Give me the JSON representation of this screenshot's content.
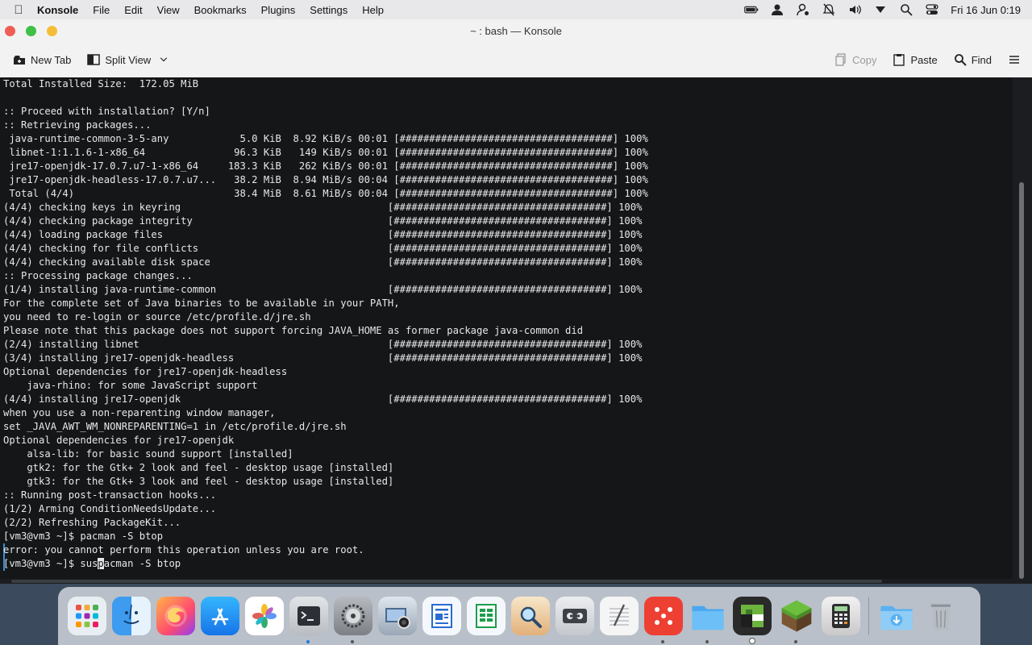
{
  "menubar": {
    "app_name": "Konsole",
    "menus": [
      "File",
      "Edit",
      "View",
      "Bookmarks",
      "Plugins",
      "Settings",
      "Help"
    ],
    "clock": "Fri 16 Jun 0:19"
  },
  "window": {
    "title": "~ : bash — Konsole"
  },
  "toolbar": {
    "new_tab": "New Tab",
    "split_view": "Split View",
    "copy": "Copy",
    "paste": "Paste",
    "find": "Find"
  },
  "terminal": {
    "lines": [
      "Total Installed Size:  172.05 MiB",
      "",
      ":: Proceed with installation? [Y/n]",
      ":: Retrieving packages...",
      " java-runtime-common-3-5-any            5.0 KiB  8.92 KiB/s 00:01 [####################################] 100%",
      " libnet-1:1.1.6-1-x86_64               96.3 KiB   149 KiB/s 00:01 [####################################] 100%",
      " jre17-openjdk-17.0.7.u7-1-x86_64     183.3 KiB   262 KiB/s 00:01 [####################################] 100%",
      " jre17-openjdk-headless-17.0.7.u7...   38.2 MiB  8.94 MiB/s 00:04 [####################################] 100%",
      " Total (4/4)                           38.4 MiB  8.61 MiB/s 00:04 [####################################] 100%",
      "(4/4) checking keys in keyring                                   [####################################] 100%",
      "(4/4) checking package integrity                                 [####################################] 100%",
      "(4/4) loading package files                                      [####################################] 100%",
      "(4/4) checking for file conflicts                                [####################################] 100%",
      "(4/4) checking available disk space                              [####################################] 100%",
      ":: Processing package changes...",
      "(1/4) installing java-runtime-common                             [####################################] 100%",
      "For the complete set of Java binaries to be available in your PATH,",
      "you need to re-login or source /etc/profile.d/jre.sh",
      "Please note that this package does not support forcing JAVA_HOME as former package java-common did",
      "(2/4) installing libnet                                          [####################################] 100%",
      "(3/4) installing jre17-openjdk-headless                          [####################################] 100%",
      "Optional dependencies for jre17-openjdk-headless",
      "    java-rhino: for some JavaScript support",
      "(4/4) installing jre17-openjdk                                   [####################################] 100%",
      "when you use a non-reparenting window manager,",
      "set _JAVA_AWT_WM_NONREPARENTING=1 in /etc/profile.d/jre.sh",
      "Optional dependencies for jre17-openjdk",
      "    alsa-lib: for basic sound support [installed]",
      "    gtk2: for the Gtk+ 2 look and feel - desktop usage [installed]",
      "    gtk3: for the Gtk+ 3 look and feel - desktop usage [installed]",
      ":: Running post-transaction hooks...",
      "(1/2) Arming ConditionNeedsUpdate...",
      "(2/2) Refreshing PackageKit...",
      "[vm3@vm3 ~]$ pacman -S btop",
      "error: you cannot perform this operation unless you are root."
    ],
    "prompt_before_cursor": "[vm3@vm3 ~]$ sus",
    "cursor_char": "p",
    "prompt_after_cursor": "acman -S btop"
  },
  "dock": {
    "apps": [
      {
        "name": "launchpad",
        "color": "#e9eef3"
      },
      {
        "name": "finder",
        "color": "#3d9bf0"
      },
      {
        "name": "firefox",
        "color": "#ff7a2f"
      },
      {
        "name": "app-store",
        "color": "#1e8df5"
      },
      {
        "name": "photos",
        "color": "#ffffff"
      },
      {
        "name": "konsole",
        "color": "#2c3036"
      },
      {
        "name": "system-settings",
        "color": "#8c8f94"
      },
      {
        "name": "screenshot",
        "color": "#4a5766"
      },
      {
        "name": "writer",
        "color": "#2a6bd1"
      },
      {
        "name": "calc",
        "color": "#1b9e4b"
      },
      {
        "name": "preview",
        "color": "#f0f0f0"
      },
      {
        "name": "tape-recorder",
        "color": "#5a5e66"
      },
      {
        "name": "text-editor",
        "color": "#f4f4f4"
      },
      {
        "name": "dice-game",
        "color": "#ee3f33"
      },
      {
        "name": "files",
        "color": "#4aa7f0"
      },
      {
        "name": "minecraft-launcher",
        "color": "#6db33f"
      },
      {
        "name": "minecraft",
        "color": "#5a8f31"
      },
      {
        "name": "calculator",
        "color": "#3a3a3c"
      },
      {
        "name": "downloads",
        "color": "#5ab0f0"
      },
      {
        "name": "trash",
        "color": "#9ea3a8"
      }
    ]
  }
}
